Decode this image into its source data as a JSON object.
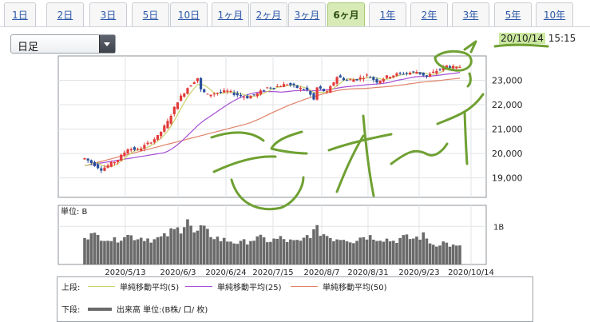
{
  "tabs": [
    {
      "label": "1日",
      "active": false
    },
    {
      "label": "2日",
      "active": false
    },
    {
      "label": "3日",
      "active": false
    },
    {
      "label": "5日",
      "active": false
    },
    {
      "label": "10日",
      "active": false
    },
    {
      "label": "1ヶ月",
      "active": false
    },
    {
      "label": "2ヶ月",
      "active": false
    },
    {
      "label": "3ヶ月",
      "active": false
    },
    {
      "label": "6ヶ月",
      "active": true
    },
    {
      "label": "1年",
      "active": false
    },
    {
      "label": "2年",
      "active": false
    },
    {
      "label": "3年",
      "active": false
    },
    {
      "label": "5年",
      "active": false
    },
    {
      "label": "10年",
      "active": false
    }
  ],
  "interval_select": {
    "value": "日足"
  },
  "timestamp": {
    "date": "20/10/14",
    "time": "15:15"
  },
  "chart_data": {
    "type": "candlestick",
    "price_axis": {
      "ticks": [
        19000,
        20000,
        21000,
        22000,
        23000
      ],
      "tick_labels": [
        "19,000",
        "20,000",
        "21,000",
        "22,000",
        "23,000"
      ],
      "ylim": [
        18200,
        24000
      ]
    },
    "x_tick_labels": [
      "2020/5/13",
      "2020/6/3",
      "2020/6/24",
      "2020/7/15",
      "2020/8/7",
      "2020/8/31",
      "2020/9/23",
      "2020/10/14"
    ],
    "volume_panel": {
      "unit_label": "単位: B",
      "tick_label": "1B"
    },
    "legend": {
      "upper_label": "上段:",
      "lower_label": "下段:",
      "series": [
        {
          "name": "単純移動平均(5)",
          "color": "#c8d36a"
        },
        {
          "name": "単純移動平均(25)",
          "color": "#a64fd4"
        },
        {
          "name": "単純移動平均(50)",
          "color": "#e0836a"
        }
      ],
      "volume_name": "出来高 単位:(B株/ 口/ 枚)",
      "volume_color": "#6a6a6a"
    },
    "up_color": "#e23b3b",
    "down_color": "#2a4f9c",
    "price_anchors": [
      [
        0,
        19800
      ],
      [
        5,
        19350
      ],
      [
        10,
        19750
      ],
      [
        13,
        20200
      ],
      [
        16,
        20150
      ],
      [
        19,
        20400
      ],
      [
        22,
        20700
      ],
      [
        25,
        21300
      ],
      [
        28,
        22150
      ],
      [
        31,
        22700
      ],
      [
        34,
        23100
      ],
      [
        35,
        22600
      ],
      [
        37,
        22400
      ],
      [
        40,
        22500
      ],
      [
        43,
        22550
      ],
      [
        46,
        22400
      ],
      [
        49,
        22300
      ],
      [
        52,
        22450
      ],
      [
        55,
        22700
      ],
      [
        58,
        22750
      ],
      [
        61,
        22850
      ],
      [
        64,
        22700
      ],
      [
        67,
        22600
      ],
      [
        69,
        22200
      ],
      [
        70,
        22700
      ],
      [
        73,
        22500
      ],
      [
        76,
        23150
      ],
      [
        79,
        23000
      ],
      [
        82,
        23050
      ],
      [
        85,
        23200
      ],
      [
        88,
        22950
      ],
      [
        91,
        23150
      ],
      [
        94,
        23250
      ],
      [
        97,
        23300
      ],
      [
        100,
        23350
      ],
      [
        103,
        23150
      ],
      [
        106,
        23400
      ],
      [
        109,
        23600
      ],
      [
        112,
        23500
      ],
      [
        113,
        23550
      ]
    ],
    "volume_anchors": [
      [
        0,
        0.78
      ],
      [
        3,
        0.75
      ],
      [
        6,
        0.72
      ],
      [
        9,
        0.62
      ],
      [
        12,
        0.78
      ],
      [
        15,
        0.72
      ],
      [
        18,
        0.7
      ],
      [
        21,
        0.65
      ],
      [
        24,
        0.72
      ],
      [
        26,
        0.85
      ],
      [
        29,
        0.95
      ],
      [
        31,
        1.25
      ],
      [
        33,
        0.78
      ],
      [
        35,
        0.95
      ],
      [
        38,
        0.78
      ],
      [
        41,
        0.65
      ],
      [
        44,
        0.62
      ],
      [
        47,
        0.55
      ],
      [
        50,
        0.65
      ],
      [
        53,
        0.68
      ],
      [
        56,
        0.62
      ],
      [
        59,
        0.68
      ],
      [
        62,
        0.6
      ],
      [
        65,
        0.58
      ],
      [
        67,
        0.75
      ],
      [
        70,
        0.9
      ],
      [
        72,
        0.8
      ],
      [
        75,
        0.68
      ],
      [
        78,
        0.7
      ],
      [
        81,
        0.62
      ],
      [
        84,
        0.75
      ],
      [
        87,
        0.72
      ],
      [
        90,
        0.68
      ],
      [
        93,
        0.62
      ],
      [
        96,
        0.7
      ],
      [
        99,
        0.68
      ],
      [
        102,
        0.75
      ],
      [
        105,
        0.52
      ],
      [
        108,
        0.58
      ],
      [
        111,
        0.48
      ],
      [
        113,
        0.45
      ]
    ]
  }
}
